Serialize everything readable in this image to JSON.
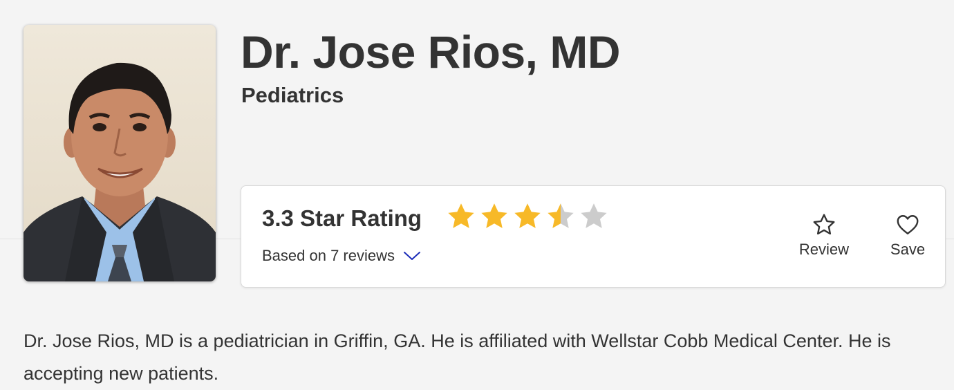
{
  "doctor": {
    "name": "Dr. Jose Rios, MD",
    "specialty": "Pediatrics",
    "photo_icon": "doctor-portrait"
  },
  "rating": {
    "label": "3.3 Star Rating",
    "value": 3.3,
    "max": 5,
    "star_filled_color": "#f7b928",
    "star_empty_color": "#cccccc",
    "review_count_label": "Based on 7 reviews",
    "expand_icon": "chevron-down-icon",
    "chevron_color": "#1a2bb8"
  },
  "actions": {
    "review": {
      "label": "Review",
      "icon": "star-outline-icon"
    },
    "save": {
      "label": "Save",
      "icon": "heart-outline-icon"
    }
  },
  "description": "Dr. Jose Rios, MD is a pediatrician in Griffin, GA. He is affiliated with Wellstar Cobb Medical Center. He is accepting new patients."
}
